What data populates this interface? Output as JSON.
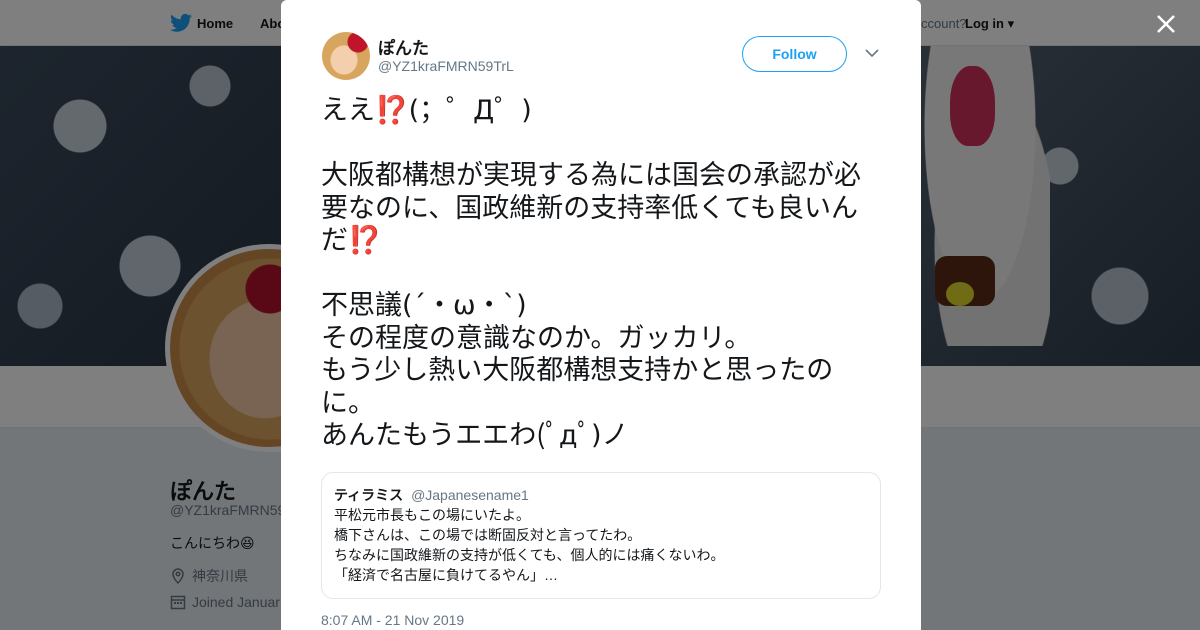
{
  "nav": {
    "home_label": "Home",
    "about_label": "Abo",
    "account_prompt": "ccount?",
    "login_label": "Log in"
  },
  "profile": {
    "name": "ぽんた",
    "handle": "@YZ1kraFMRN59",
    "bio": "こんにちわ😆",
    "location": "神奈川県",
    "joined": "Joined Januar"
  },
  "tweet": {
    "author_name": "ぽんた",
    "author_handle": "@YZ1kraFMRN59TrL",
    "follow_label": "Follow",
    "lines": [
      "ええ⁉️(；゜Д゜)",
      "",
      "大阪都構想が実現する為には国会の承認が必",
      "要なのに、国政維新の支持率低くても良いん",
      "だ⁉️",
      "",
      "不思議(´・ω・`)",
      "その程度の意識なのか。ガッカリ。",
      "もう少し熱い大阪都構想支持かと思ったの",
      "に。",
      "あんたもうエエわ(ﾟдﾟ)ノ"
    ],
    "quote": {
      "name": "ティラミス",
      "handle": "@Japanesename1",
      "lines": [
        "平松元市長もこの場にいたよ。",
        "橋下さんは、この場では断固反対と言ってたわ。",
        "ちなみに国政維新の支持が低くても、個人的には痛くないわ。",
        "「経済で名古屋に負けてるやん」…"
      ]
    },
    "timestamp": "8:07 AM - 21 Nov 2019"
  },
  "icons": {
    "brand": "twitter-bird-icon",
    "close": "close-icon",
    "caret": "chevron-down-icon",
    "location": "map-pin-icon",
    "calendar": "calendar-icon"
  },
  "colors": {
    "accent": "#1da1f2",
    "text": "#14171a",
    "muted": "#657786"
  }
}
